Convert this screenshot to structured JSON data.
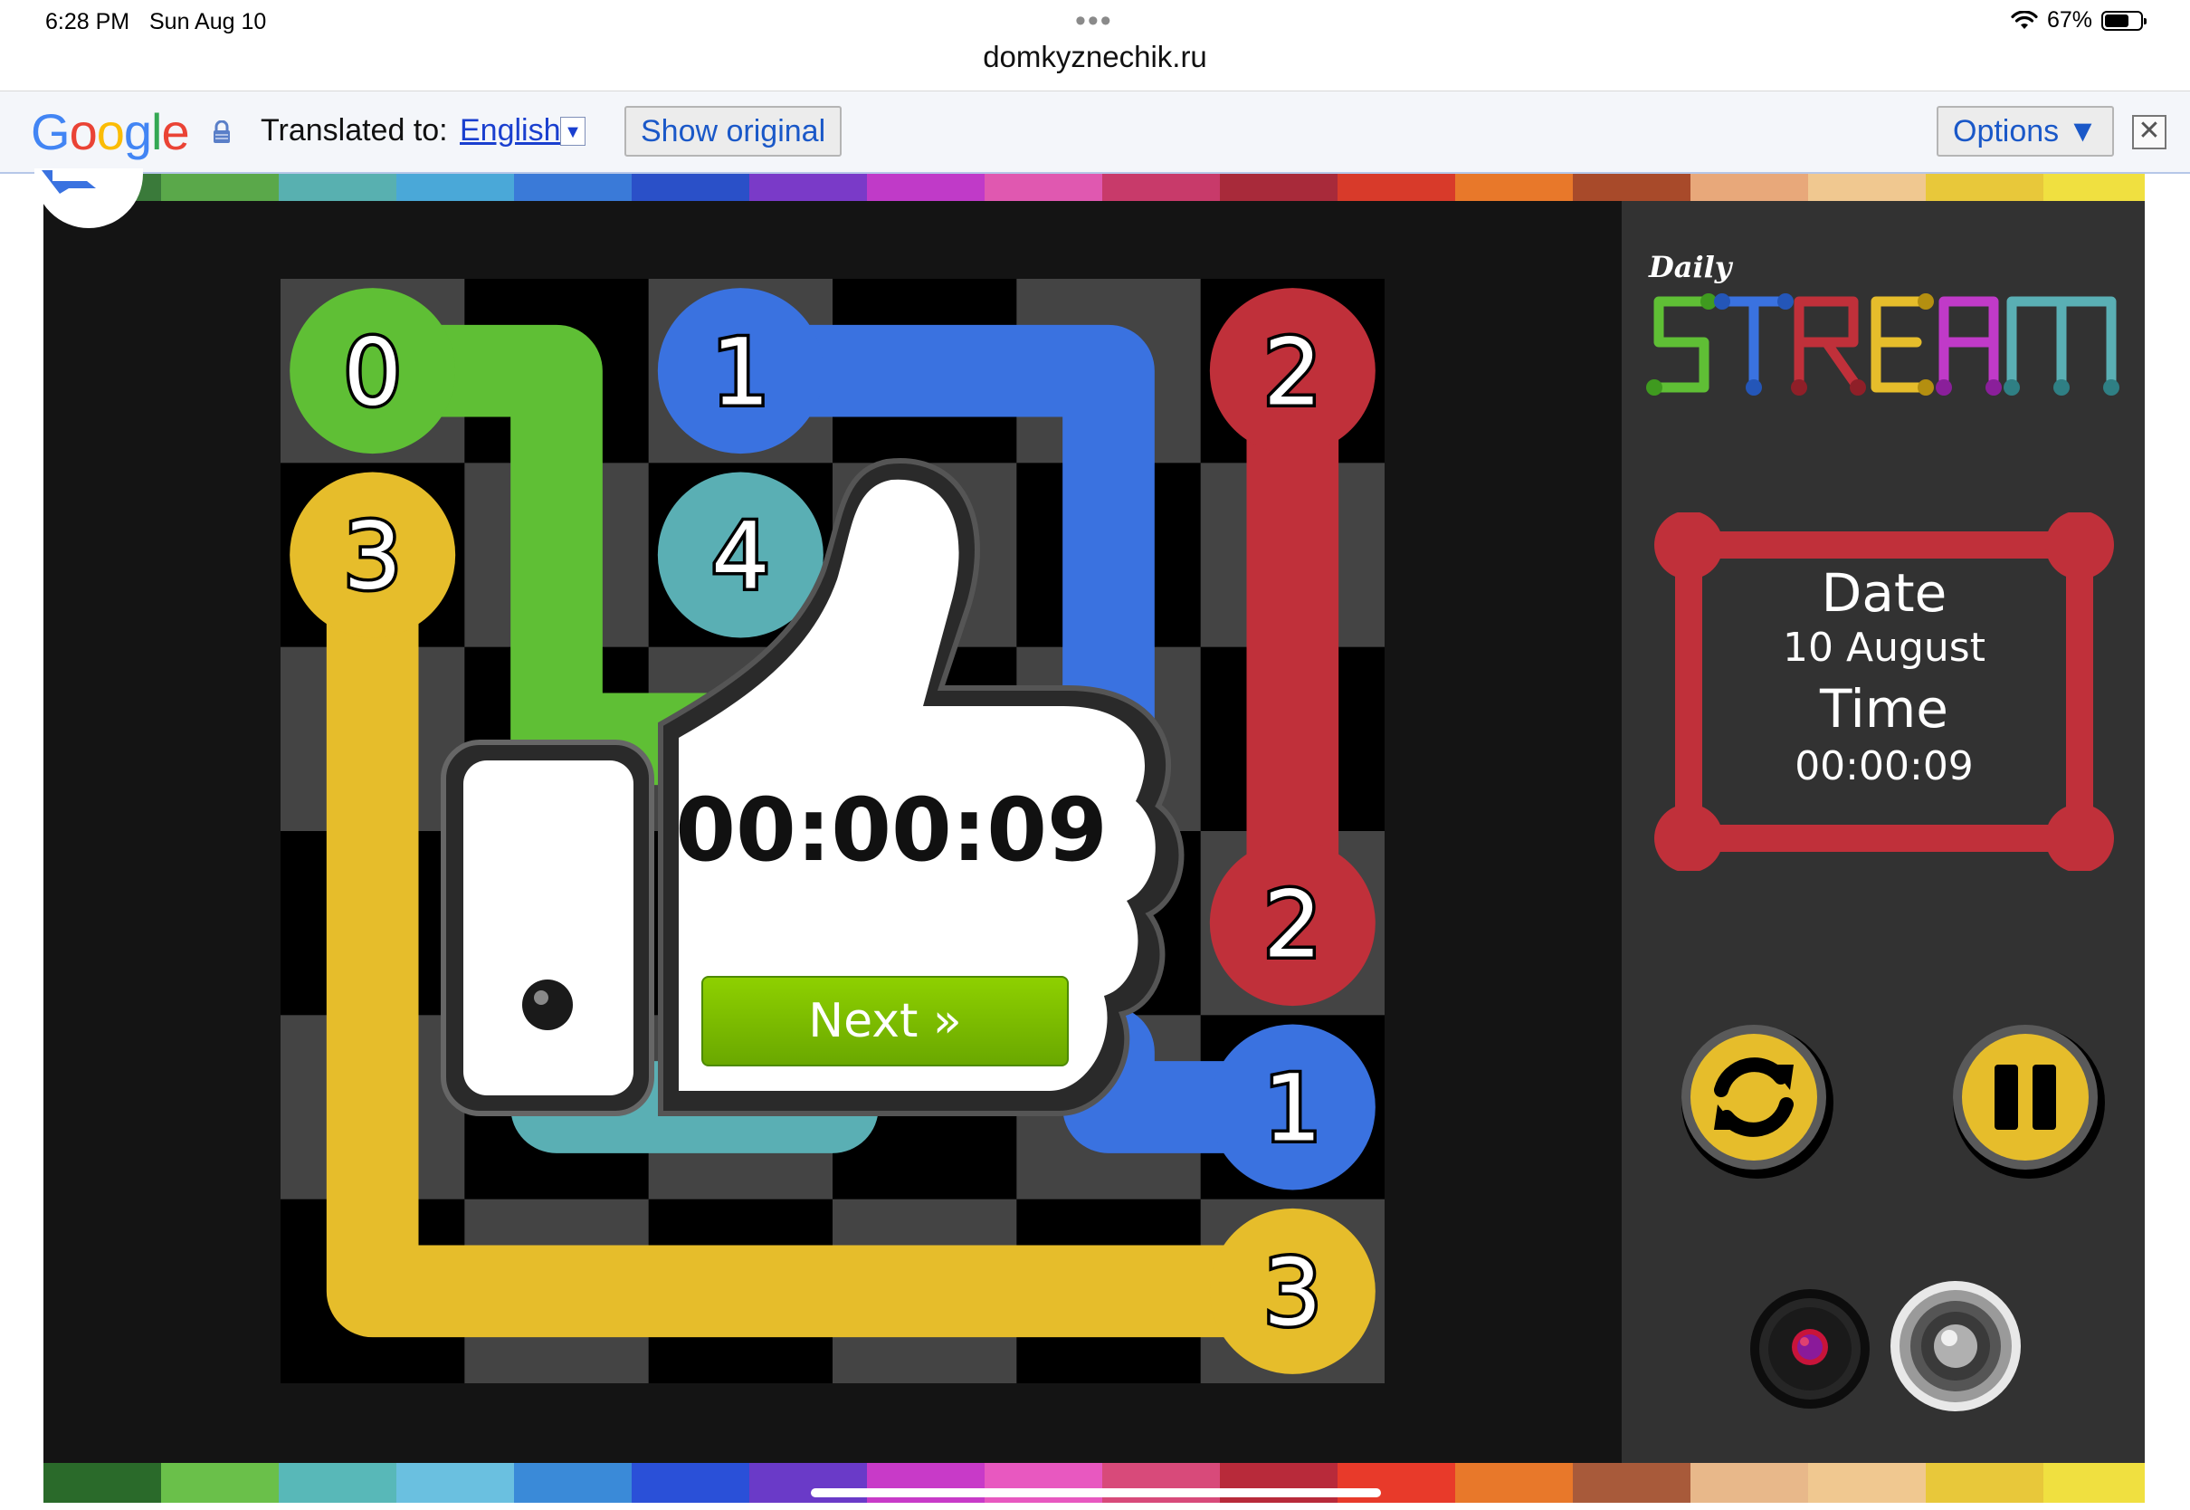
{
  "status": {
    "time": "6:28 PM",
    "date": "Sun Aug 10",
    "battery": "67%"
  },
  "browser": {
    "url": "domkyznechik.ru"
  },
  "translate_bar": {
    "logo": "Google",
    "label": "Translated to:",
    "language": "English",
    "show_original": "Show original",
    "options": "Options ▼"
  },
  "game": {
    "logo_daily": "Daily",
    "logo_title": "STREAM",
    "info": {
      "date_label": "Date",
      "date_value": "10 August",
      "time_label": "Time",
      "time_value": "00:00:09"
    },
    "result_time": "00:00:09",
    "next_label": "Next »",
    "dots": [
      "0",
      "1",
      "2",
      "3",
      "4",
      "2",
      "1",
      "3"
    ],
    "colors": {
      "green": "#5fbf35",
      "blue": "#3a72e0",
      "red": "#c0303a",
      "yellow": "#e6bd2b",
      "teal": "#5aafb4",
      "button_green": "#7ab800",
      "panel": "#323232"
    }
  }
}
